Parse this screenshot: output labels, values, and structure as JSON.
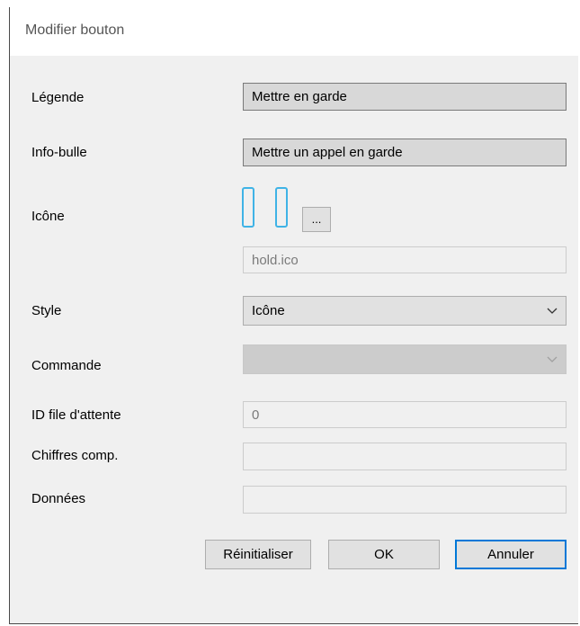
{
  "dialog": {
    "title": "Modifier bouton",
    "accent": "#0078d7",
    "icon_accent": "#3fb3e6"
  },
  "form": {
    "legend_label": "Légende",
    "legend_value": "Mettre en garde",
    "tooltip_label": "Info-bulle",
    "tooltip_value": "Mettre un appel en garde",
    "icon_label": "Icône",
    "icon_preview": "pause-icon",
    "browse_label": "...",
    "icon_file": "hold.ico",
    "style_label": "Style",
    "style_value": "Icône",
    "command_label": "Commande",
    "command_value": "",
    "queue_label": "ID file d'attente",
    "queue_value": "0",
    "digits_label": "Chiffres comp.",
    "digits_value": "",
    "data_label": "Données",
    "data_value": ""
  },
  "buttons": {
    "reset": "Réinitialiser",
    "ok": "OK",
    "cancel": "Annuler"
  }
}
